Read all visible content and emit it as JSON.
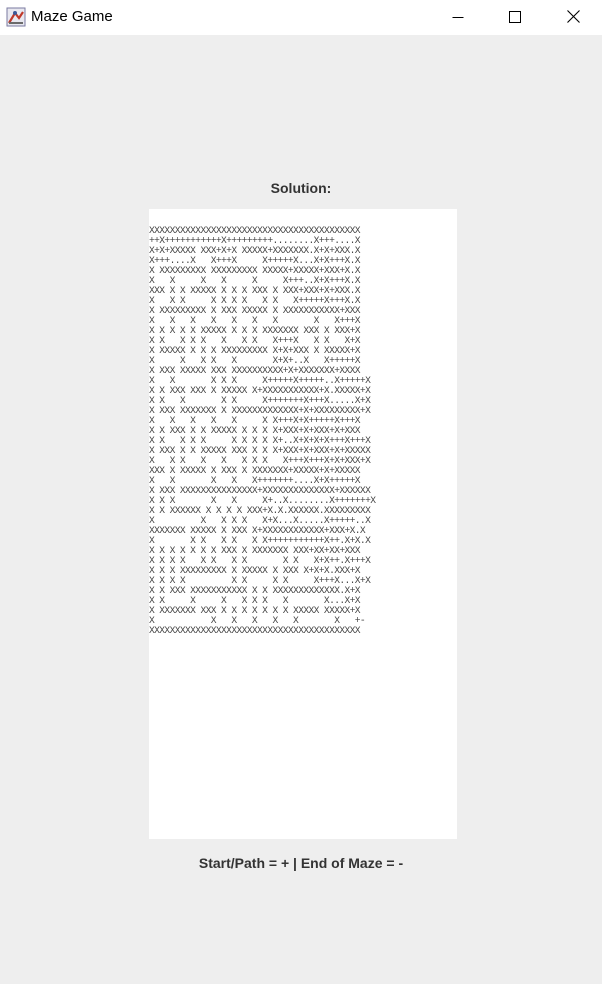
{
  "window": {
    "title": "Maze Game",
    "app_icon": "java-app-icon",
    "controls": {
      "minimize_icon": "minimize-icon",
      "maximize_icon": "maximize-icon",
      "close_icon": "close-icon"
    }
  },
  "main": {
    "solution_label": "Solution:",
    "legend_label": "Start/Path = + | End of Maze = -",
    "maze_rows": [
      "XXXXXXXXXXXXXXXXXXXXXXXXXXXXXXXXXXXXXXXXX",
      "++X+++++++++++X+++++++++........X+++....X",
      "X+X+XXXXX XXX+X+X XXXXX+XXXXXXX.X+X+XXX.X",
      "X+++....X   X+++X     X+++++X...X+X+++X.X",
      "X XXXXXXXXX XXXXXXXXX XXXXX+XXXXX+XXX+X.X",
      "X   X     X   X     X     X+++..X+X+++X.X",
      "XXX X X XXXXX X X X XXX X XXX+XXX+X+XXX.X",
      "X   X X     X X X X   X X   X+++++X+++X.X",
      "X XXXXXXXXX X XXX XXXXX X XXXXXXXXXXX+XXX",
      "X   X   X   X   X   X   X       X   X+++X",
      "X X X X X XXXXX X X X XXXXXXX XXX X XXX+X",
      "X X   X X X   X   X X   X+++X   X X   X+X",
      "X XXXXX X X X XXXXXXXXX X+X+XXX X XXXXX+X",
      "X     X   X X   X       X+X+..X   X+++++X",
      "X XXX XXXXX XXX XXXXXXXXXX+X+XXXXXXX+XXXX",
      "X   X       X X X     X+++++X+++++..X+++++X",
      "X X XXX XXX X XXXXX X+XXXXXXXXXXX+X.XXXXX+X",
      "X X   X       X X     X+++++++X+++X.....X+X",
      "X XXX XXXXXXX X XXXXXXXXXXXXX+X+XXXXXXXXX+X",
      "X   X   X   X   X     X X+++X+X+++++X+++X",
      "X X XXX X X XXXXX X X X X+XXX+X+XXX+X+XXX",
      "X X   X X X     X X X X X+..X+X+X+X+++X+++X",
      "X XXX X X XXXXX XXX X X X+XXX+X+XXX+X+XXXXX",
      "X   X X   X   X   X X X   X+++X+++X+X+XXX+X",
      "XXX X XXXXX X XXX X XXXXXXX+XXXXX+X+XXXXX",
      "X   X       X   X   X+++++++....X+X+++++X",
      "X XXX XXXXXXXXXXXXXXX+XXXXXXXXXXXXXX+XXXXXX",
      "X X X       X   X     X+..X........X+++++++X",
      "X X XXXXXX X X X X XXX+X.X.XXXXXX.XXXXXXXXX",
      "X         X   X X X   X+X...X.....X+++++..X",
      "XXXXXXX XXXXX X XXX X+XXXXXXXXXXXX+XXX+X.X",
      "X       X X   X X   X X+++++++++++X++.X+X.X",
      "X X X X X X X XXX X XXXXXXX XXX+XX+XX+XXX",
      "X X X X   X X   X X       X X   X+X++.X+++X",
      "X X X XXXXXXXXX X XXXXX X XXX X+X+X.XXX+X",
      "X X X X         X X     X X     X+++X...X+X",
      "X X XXX XXXXXXXXXXX X X XXXXXXXXXXXXX.X+X",
      "X X     X     X   X X X   X       X...X+X",
      "X XXXXXXX XXX X X X X X X X XXXXX XXXXX+X",
      "X           X   X   X   X   X       X   +-",
      "XXXXXXXXXXXXXXXXXXXXXXXXXXXXXXXXXXXXXXXXX"
    ]
  }
}
